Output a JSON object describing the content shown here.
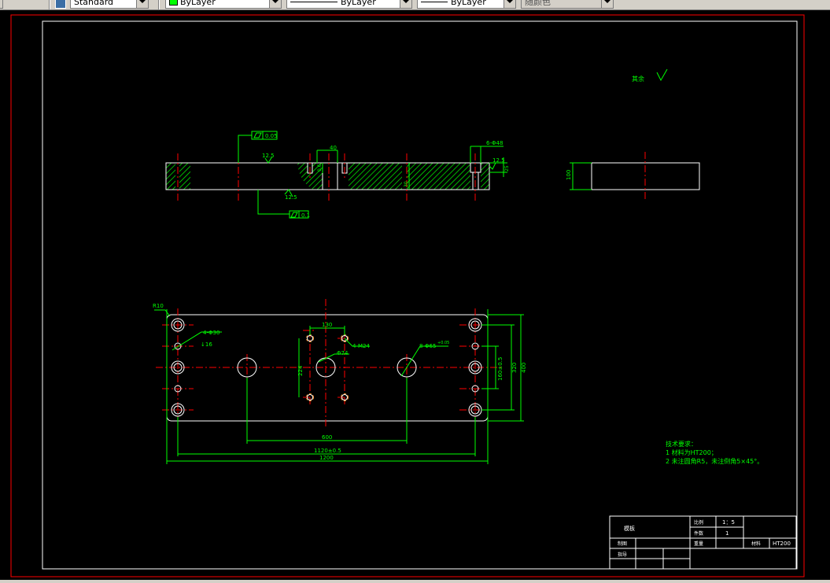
{
  "toolbar": {
    "textstyle": "Standard",
    "layer": "ByLayer",
    "linetype": "ByLayer",
    "lineweight": "ByLayer",
    "plotstyle": "随颜色",
    "layer_color": "#00ff00"
  },
  "drawing": {
    "roughness_note": "其余",
    "front_view": {
      "flatness_top": "0.05",
      "flatness_bottom": "0.1",
      "rough_top": "12.5",
      "rough_bottom": "12.5",
      "dim_40": "40",
      "dim_06": "0.6",
      "dim_30": "30",
      "dim_6phi48": "6-Φ48",
      "rough_right": "12.5",
      "dim_25": "25"
    },
    "side_view": {
      "thickness": "100"
    },
    "plan_view": {
      "r_corner": "R10",
      "cbore_call": "4-Φ30",
      "cbore_depth": "↓16",
      "dim_130": "130",
      "tap_call": "4-M24",
      "center_bore": "Φ74",
      "dim_224": "224",
      "hole_call": "8-Φ65",
      "hole_tol": "+0.05",
      "dim_600": "600",
      "dim_1120": "1120±0.5",
      "dim_1200": "1200",
      "dim_160": "160±0.5",
      "dim_320": "320",
      "dim_400": "400"
    },
    "notes": {
      "title": "技术要求：",
      "line1": "1  材料为HT200；",
      "line2": "2  未注圆角R5，未注倒角5×45°。"
    },
    "title_block": {
      "part_name": "模板",
      "scale_label": "比例",
      "scale_value": "1：5",
      "qty_label": "件数",
      "qty_value": "1",
      "drawn_label": "制图",
      "weight_label": "重量",
      "material_label": "材料",
      "material_value": "HT200",
      "checked_label": "指导"
    }
  }
}
